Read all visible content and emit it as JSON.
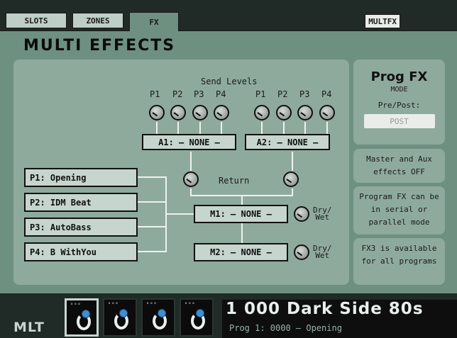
{
  "tabs": [
    {
      "label": "SLOTS",
      "active": false
    },
    {
      "label": "ZONES",
      "active": false
    },
    {
      "label": "FX",
      "active": true
    }
  ],
  "multfx_label": "MULTFX",
  "page_title": "MULTI EFFECTS",
  "send_levels": {
    "title": "Send Levels",
    "group_a": [
      "P1",
      "P2",
      "P3",
      "P4"
    ],
    "group_b": [
      "P1",
      "P2",
      "P3",
      "P4"
    ]
  },
  "aux": {
    "a1": "A1: – NONE –",
    "a2": "A2: – NONE –",
    "return_label": "Return"
  },
  "programs": [
    "P1: Opening",
    "P2: IDM Beat",
    "P3: AutoBass",
    "P4: B WithYou"
  ],
  "master": {
    "m1": "M1: – NONE –",
    "m2": "M2: – NONE –",
    "drywet_1": "Dry/",
    "drywet_2": "Wet"
  },
  "right_panel": {
    "title": "Prog FX",
    "mode": "MODE",
    "prepost_label": "Pre/Post:",
    "prepost_value": "POST",
    "note1": "Master and Aux effects OFF",
    "note2": "Program FX can be in serial or parallel mode",
    "note3": "FX3 is available for all programs"
  },
  "bottom": {
    "mlt": "MLT",
    "slots": [
      {
        "dots": "°°°",
        "active": true
      },
      {
        "dots": "°°°",
        "active": false
      },
      {
        "dots": "°°°",
        "active": false
      },
      {
        "dots": "°°°",
        "active": false
      }
    ],
    "program_name": "1 000 Dark Side 80s",
    "program_sub": "Prog 1: 0000 – Opening"
  },
  "colors": {
    "screen_bg": "#6e9080",
    "panel_bg": "#8eaa9d",
    "box_bg": "#c6d5cd",
    "bar_bg": "#202a26",
    "slot_blue": "#3f8ed4"
  }
}
